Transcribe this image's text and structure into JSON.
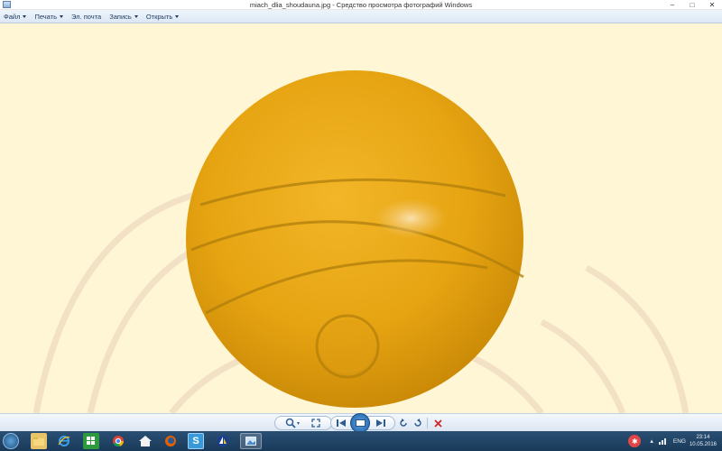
{
  "window": {
    "title": "miach_dlia_shoudauna.jpg - Средство просмотра фотографий Windows",
    "minimize_glyph": "–",
    "maximize_glyph": "□",
    "close_glyph": "✕"
  },
  "menu": {
    "items": [
      {
        "label": "Файл",
        "has_dropdown": true
      },
      {
        "label": "Печать",
        "has_dropdown": true
      },
      {
        "label": "Эл. почта",
        "has_dropdown": false
      },
      {
        "label": "Запись",
        "has_dropdown": true
      },
      {
        "label": "Открыть",
        "has_dropdown": true
      }
    ]
  },
  "image": {
    "subject": "yellow ball",
    "ball_color": "#e6a412",
    "background_color": "#fff6d6"
  },
  "controls": {
    "zoom_icon": "magnifier-icon",
    "fit_icon": "actual-size-icon",
    "prev_icon": "previous-icon",
    "slideshow_icon": "slideshow-icon",
    "next_icon": "next-icon",
    "rotate_ccw_icon": "rotate-ccw-icon",
    "rotate_cw_icon": "rotate-cw-icon",
    "delete_icon": "delete-icon"
  },
  "taskbar": {
    "apps": [
      "start",
      "file-explorer",
      "internet-explorer",
      "store",
      "chrome",
      "home",
      "firefox",
      "skype",
      "sailboat",
      "photo-viewer"
    ],
    "tray": {
      "lang": "ENG",
      "time": "23:14",
      "date": "10.05.2016"
    }
  },
  "colors": {
    "accent": "#2d5b93",
    "taskbar": "#1f4266",
    "delete": "#d0262b"
  }
}
